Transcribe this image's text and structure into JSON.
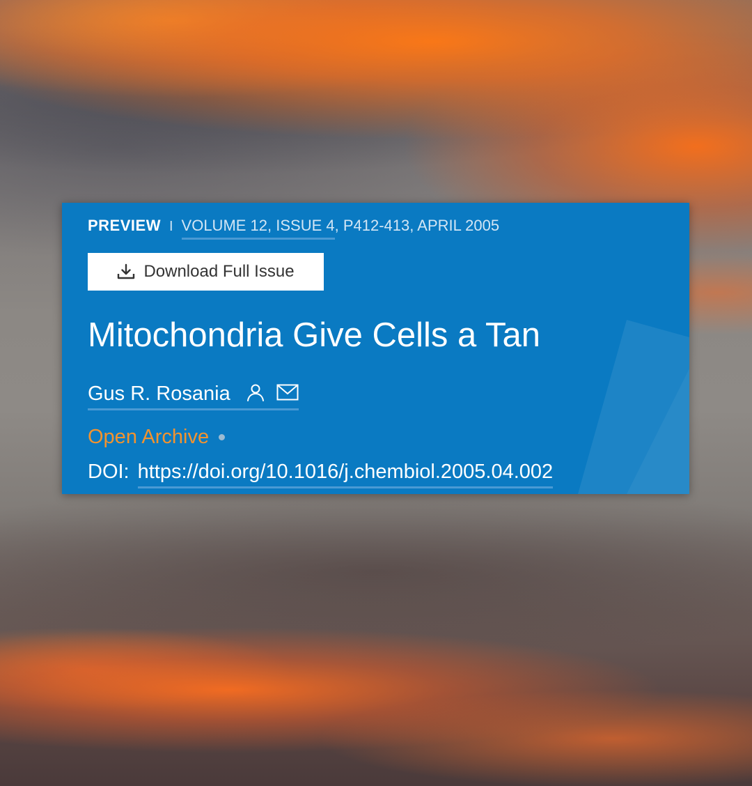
{
  "background": {
    "description_colors": {
      "orange": "#ff7a1a",
      "cloud_gray": "#7c7878",
      "dark_cloud": "#4a3a3a"
    }
  },
  "card": {
    "bg_color": "#0a7ac2",
    "meta": {
      "preview_label": "PREVIEW",
      "separator": "I",
      "volume_link": "VOLUME 12, ISSUE 4",
      "pages_date": ", P412-413, APRIL 2005"
    },
    "download_button": {
      "label": "Download Full Issue",
      "icon": "download-icon"
    },
    "title": "Mitochondria Give Cells a Tan",
    "author": {
      "name": "Gus R. Rosania",
      "icons": [
        "person-icon",
        "mail-icon"
      ]
    },
    "access": {
      "label": "Open Archive",
      "color": "#f2932f"
    },
    "doi": {
      "label": "DOI:",
      "url": "https://doi.org/10.1016/j.chembiol.2005.04.002"
    }
  }
}
